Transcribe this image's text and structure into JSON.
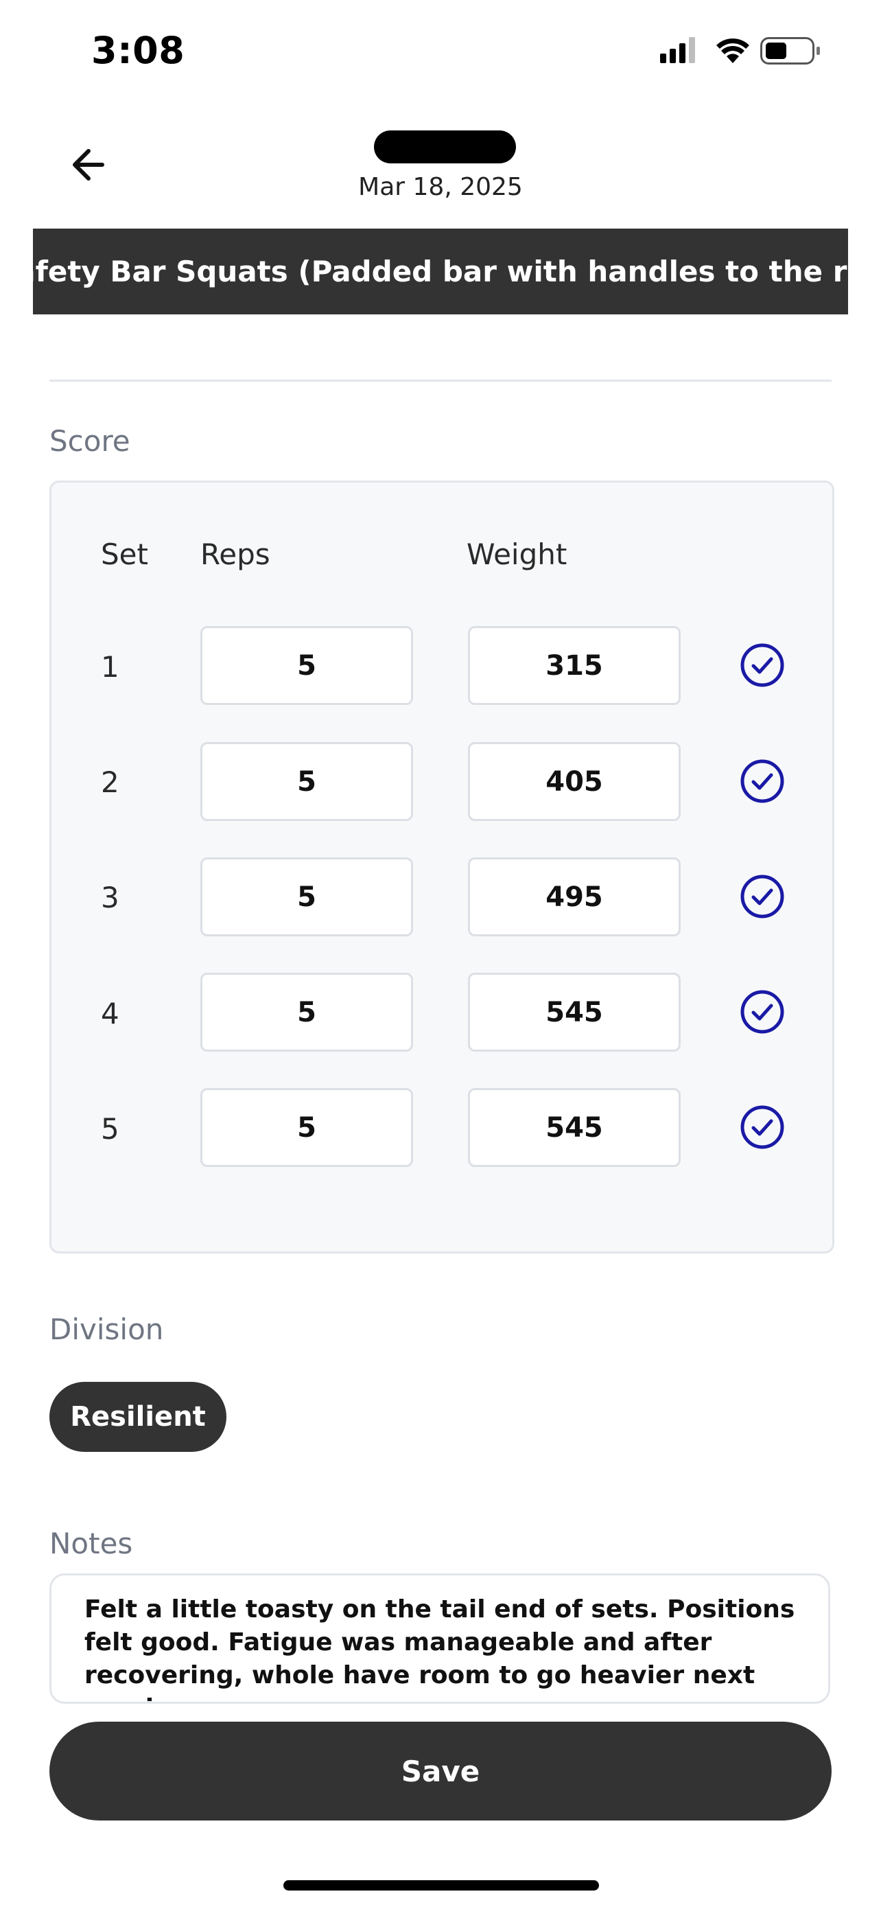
{
  "status_bar": {
    "time": "3:08",
    "icons": [
      "signal-icon",
      "wifi-icon",
      "battery-icon"
    ]
  },
  "header": {
    "back_icon": "arrow-left-icon",
    "date": "Mar 18, 2025"
  },
  "exercise": {
    "name": "Safety Bar Squats (Padded bar with handles to the right of cubbies)"
  },
  "score": {
    "label": "Score",
    "columns": [
      "Set",
      "Reps",
      "Weight"
    ],
    "rows": [
      {
        "set": "1",
        "reps": "5",
        "weight": "315",
        "checked": true
      },
      {
        "set": "2",
        "reps": "5",
        "weight": "405",
        "checked": true
      },
      {
        "set": "3",
        "reps": "5",
        "weight": "495",
        "checked": true
      },
      {
        "set": "4",
        "reps": "5",
        "weight": "545",
        "checked": true
      },
      {
        "set": "5",
        "reps": "5",
        "weight": "545",
        "checked": true
      }
    ]
  },
  "division": {
    "label": "Division",
    "selected": "Resilient"
  },
  "notes": {
    "label": "Notes",
    "value": "Felt a little toasty on the tail end of sets. Positions felt good. Fatigue was manageable and after recovering, whole have room to go heavier next session."
  },
  "actions": {
    "save_label": "Save"
  },
  "colors": {
    "accent": "#1a1aa6",
    "dark": "#333333",
    "muted_label": "#6f7582"
  }
}
